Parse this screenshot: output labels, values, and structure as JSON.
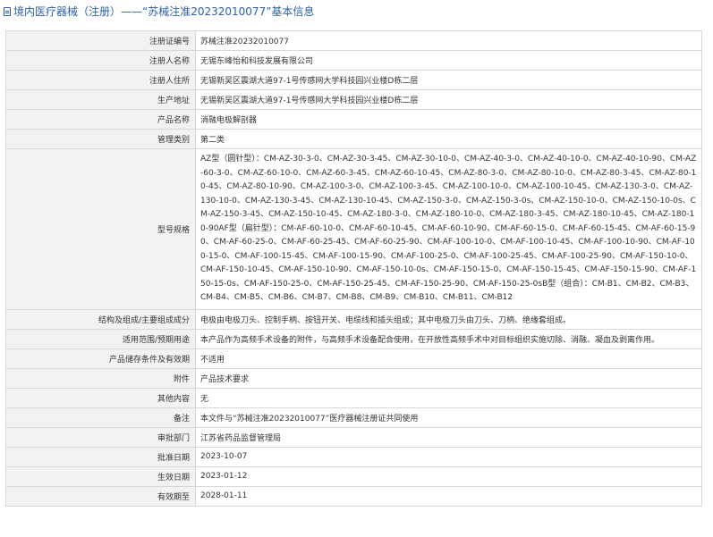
{
  "header": {
    "title": "境内医疗器械（注册）——“苏械注准20232010077”基本信息"
  },
  "rows": [
    {
      "label": "注册证编号",
      "value": "苏械注准20232010077"
    },
    {
      "label": "注册人名称",
      "value": "无锡东峰怡和科技发展有限公司"
    },
    {
      "label": "注册人住所",
      "value": "无锡新吴区震湖大道97-1号传感网大学科技园兴业楼D栋二层"
    },
    {
      "label": "生产地址",
      "value": "无锡新吴区震湖大道97-1号传感网大学科技园兴业楼D栋二层"
    },
    {
      "label": "产品名称",
      "value": "消融电极解剖器"
    },
    {
      "label": "管理类别",
      "value": "第二类"
    },
    {
      "label": "型号规格",
      "value": "AZ型（圆针型）：CM-AZ-30-3-0、CM-AZ-30-3-45、CM-AZ-30-10-0、CM-AZ-40-3-0、CM-AZ-40-10-0、CM-AZ-40-10-90、CM-AZ-60-3-0、CM-AZ-60-10-0、CM-AZ-60-3-45、CM-AZ-60-10-45、CM-AZ-80-3-0、CM-AZ-80-10-0、CM-AZ-80-3-45、CM-AZ-80-10-45、CM-AZ-80-10-90、CM-AZ-100-3-0、CM-AZ-100-3-45、CM-AZ-100-10-0、CM-AZ-100-10-45、CM-AZ-130-3-0、CM-AZ-130-10-0、CM-AZ-130-3-45、CM-AZ-130-10-45、CM-AZ-150-3-0、CM-AZ-150-3-0s、CM-AZ-150-10-0、CM-AZ-150-10-0s、CM-AZ-150-3-45、CM-AZ-150-10-45、CM-AZ-180-3-0、CM-AZ-180-10-0、CM-AZ-180-3-45、CM-AZ-180-10-45、CM-AZ-180-10-90AF型（扁针型）：CM-AF-60-10-0、CM-AF-60-10-45、CM-AF-60-10-90、CM-AF-60-15-0、CM-AF-60-15-45、CM-AF-60-15-90、CM-AF-60-25-0、CM-AF-60-25-45、CM-AF-60-25-90、CM-AF-100-10-0、CM-AF-100-10-45、CM-AF-100-10-90、CM-AF-100-15-0、CM-AF-100-15-45、CM-AF-100-15-90、CM-AF-100-25-0、CM-AF-100-25-45、CM-AF-100-25-90、CM-AF-150-10-0、CM-AF-150-10-45、CM-AF-150-10-90、CM-AF-150-10-0s、CM-AF-150-15-0、CM-AF-150-15-45、CM-AF-150-15-90、CM-AF-150-15-0s、CM-AF-150-25-0、CM-AF-150-25-45、CM-AF-150-25-90、CM-AF-150-25-0sB型（组合）：CM-B1、CM-B2、CM-B3、CM-B4、CM-B5、CM-B6、CM-B7、CM-B8、CM-B9、CM-B10、CM-B11、CM-B12"
    },
    {
      "label": "结构及组成/主要组成成分",
      "value": "电极由电极刀头、控制手柄、按钮开关、电缆线和插头组成；其中电极刀头由刀头、刀柄、绝缘套组成。"
    },
    {
      "label": "适用范围/预期用途",
      "value": "本产品作为高频手术设备的附件，与高频手术设备配合使用，在开放性高频手术中对目标组织实施切除、消融、凝血及剥离作用。"
    },
    {
      "label": "产品储存条件及有效期",
      "value": "不适用"
    },
    {
      "label": "附件",
      "value": "产品技术要求"
    },
    {
      "label": "其他内容",
      "value": "无"
    },
    {
      "label": "备注",
      "value": "本文件与“苏械注准20232010077”医疗器械注册证共同使用"
    },
    {
      "label": "审批部门",
      "value": "江苏省药品监督管理局"
    },
    {
      "label": "批准日期",
      "value": "2023-10-07"
    },
    {
      "label": "生效日期",
      "value": "2023-01-12"
    },
    {
      "label": "有效期至",
      "value": "2028-01-11"
    }
  ]
}
